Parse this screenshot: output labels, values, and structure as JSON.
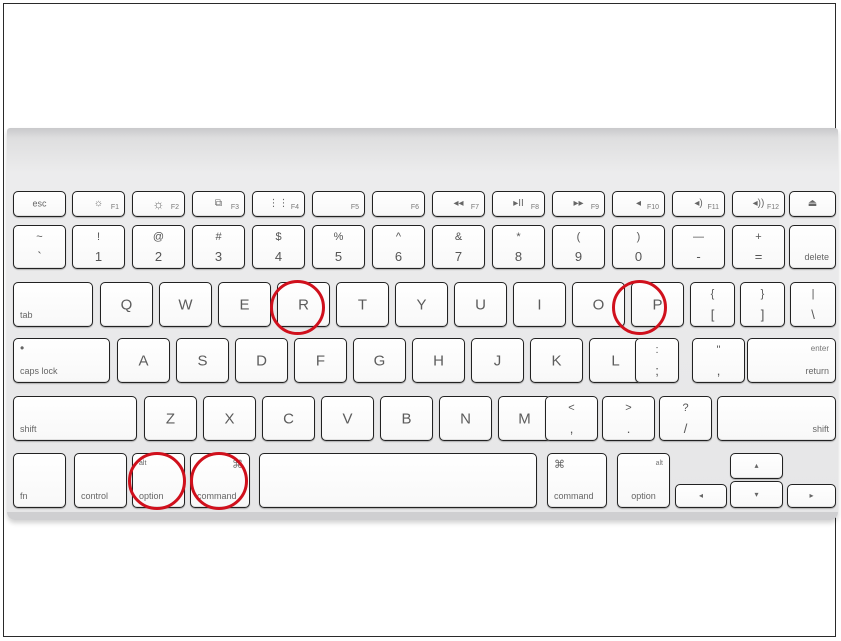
{
  "accent_color": "#d0101c",
  "function_row": [
    {
      "name": "esc-key",
      "main": "esc"
    },
    {
      "name": "f1-key",
      "icon": "☼",
      "icon_name": "brightness-down-icon",
      "fnum": "F1"
    },
    {
      "name": "f2-key",
      "icon": "☼",
      "icon_name": "brightness-up-icon",
      "fnum": "F2"
    },
    {
      "name": "f3-key",
      "icon": "⧉",
      "icon_name": "mission-control-icon",
      "fnum": "F3"
    },
    {
      "name": "f4-key",
      "icon": "⋮⋮",
      "icon_name": "launchpad-icon",
      "fnum": "F4"
    },
    {
      "name": "f5-key",
      "fnum": "F5"
    },
    {
      "name": "f6-key",
      "fnum": "F6"
    },
    {
      "name": "f7-key",
      "icon": "◂◂",
      "icon_name": "rewind-icon",
      "fnum": "F7"
    },
    {
      "name": "f8-key",
      "icon": "▸II",
      "icon_name": "play-pause-icon",
      "fnum": "F8"
    },
    {
      "name": "f9-key",
      "icon": "▸▸",
      "icon_name": "fast-forward-icon",
      "fnum": "F9"
    },
    {
      "name": "f10-key",
      "icon": "◂",
      "icon_name": "mute-icon",
      "fnum": "F10"
    },
    {
      "name": "f11-key",
      "icon": "◂)",
      "icon_name": "volume-down-icon",
      "fnum": "F11"
    },
    {
      "name": "f12-key",
      "icon": "◂))",
      "icon_name": "volume-up-icon",
      "fnum": "F12"
    },
    {
      "name": "eject-key",
      "icon": "⏏",
      "icon_name": "eject-icon"
    }
  ],
  "number_row": [
    {
      "upper": "~",
      "lower": "`"
    },
    {
      "upper": "!",
      "lower": "1"
    },
    {
      "upper": "@",
      "lower": "2"
    },
    {
      "upper": "#",
      "lower": "3"
    },
    {
      "upper": "$",
      "lower": "4"
    },
    {
      "upper": "%",
      "lower": "5"
    },
    {
      "upper": "^",
      "lower": "6"
    },
    {
      "upper": "&",
      "lower": "7"
    },
    {
      "upper": "*",
      "lower": "8"
    },
    {
      "upper": "(",
      "lower": "9"
    },
    {
      "upper": ")",
      "lower": "0"
    },
    {
      "upper": "—",
      "lower": "-"
    },
    {
      "upper": "+",
      "lower": "="
    }
  ],
  "delete_label": "delete",
  "tab_label": "tab",
  "qwerty_row": [
    "Q",
    "W",
    "E",
    "R",
    "T",
    "Y",
    "U",
    "I",
    "O",
    "P"
  ],
  "bracket_keys": [
    {
      "upper": "{",
      "lower": "["
    },
    {
      "upper": "}",
      "lower": "]"
    },
    {
      "upper": "|",
      "lower": "\\"
    }
  ],
  "caps_dot": "•",
  "caps_label": "caps lock",
  "home_row": [
    "A",
    "S",
    "D",
    "F",
    "G",
    "H",
    "J",
    "K",
    "L"
  ],
  "punct_home": [
    {
      "upper": ":",
      "lower": ";"
    },
    {
      "upper": "\"",
      "lower": ","
    }
  ],
  "enter_upper": "enter",
  "enter_lower": "return",
  "shift_label": "shift",
  "bottom_letters": [
    "Z",
    "X",
    "C",
    "V",
    "B",
    "N",
    "M"
  ],
  "punct_bottom": [
    {
      "upper": "<",
      "lower": ","
    },
    {
      "upper": ">",
      "lower": "."
    },
    {
      "upper": "?",
      "lower": "/"
    }
  ],
  "fn_label": "fn",
  "control_label": "control",
  "alt_label": "alt",
  "option_label": "option",
  "cmd_symbol": "⌘",
  "command_label": "command",
  "arrow_glyphs": {
    "left": "◂",
    "up": "▴",
    "down": "▾",
    "right": "▸"
  }
}
